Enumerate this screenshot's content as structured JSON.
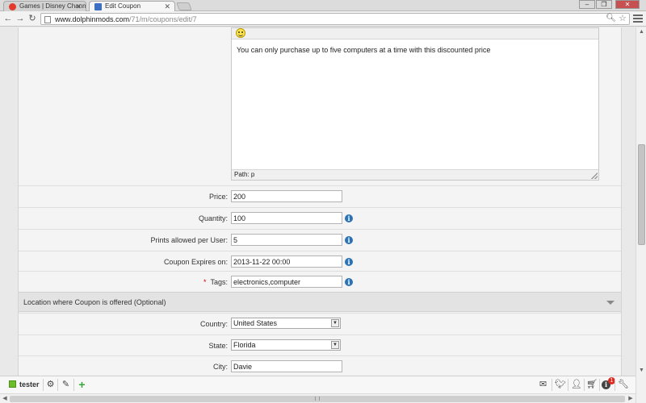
{
  "browser": {
    "tabs": [
      {
        "title": "Games | Disney Channel ⊞",
        "favicon_color": "#e23b2e",
        "active": false
      },
      {
        "title": "Edit Coupon",
        "favicon_color": "#3d6fc4",
        "active": true
      }
    ],
    "url_host": "www.dolphinmods.com",
    "url_path": "/71/m/coupons/edit/7",
    "back_icon": "arrow-left-icon",
    "forward_icon": "arrow-right-icon",
    "reload_icon": "reload-icon"
  },
  "editor": {
    "content": "You can only purchase up to five computers at a time with this discounted price",
    "status_path": "Path: p"
  },
  "form": {
    "price": {
      "label": "Price:",
      "value": "200"
    },
    "quantity": {
      "label": "Quantity:",
      "value": "100"
    },
    "prints": {
      "label": "Prints allowed per User:",
      "value": "5"
    },
    "expires": {
      "label": "Coupon Expires on:",
      "value": "2013-11-22 00:00"
    },
    "tags": {
      "label": "Tags:",
      "required_mark": "*",
      "value": "electronics,computer"
    },
    "location_section": "Location where Coupon is offered (Optional)",
    "country": {
      "label": "Country:",
      "value": "United States"
    },
    "state": {
      "label": "State:",
      "value": "Florida"
    },
    "city": {
      "label": "City:",
      "value": "Davie"
    },
    "info_glyph": "i"
  },
  "appbar": {
    "username": "tester",
    "notification_count": "1"
  },
  "colors": {
    "info_blue": "#2a72b5",
    "user_green": "#6bbd2a",
    "badge_red": "#e02a1f"
  }
}
